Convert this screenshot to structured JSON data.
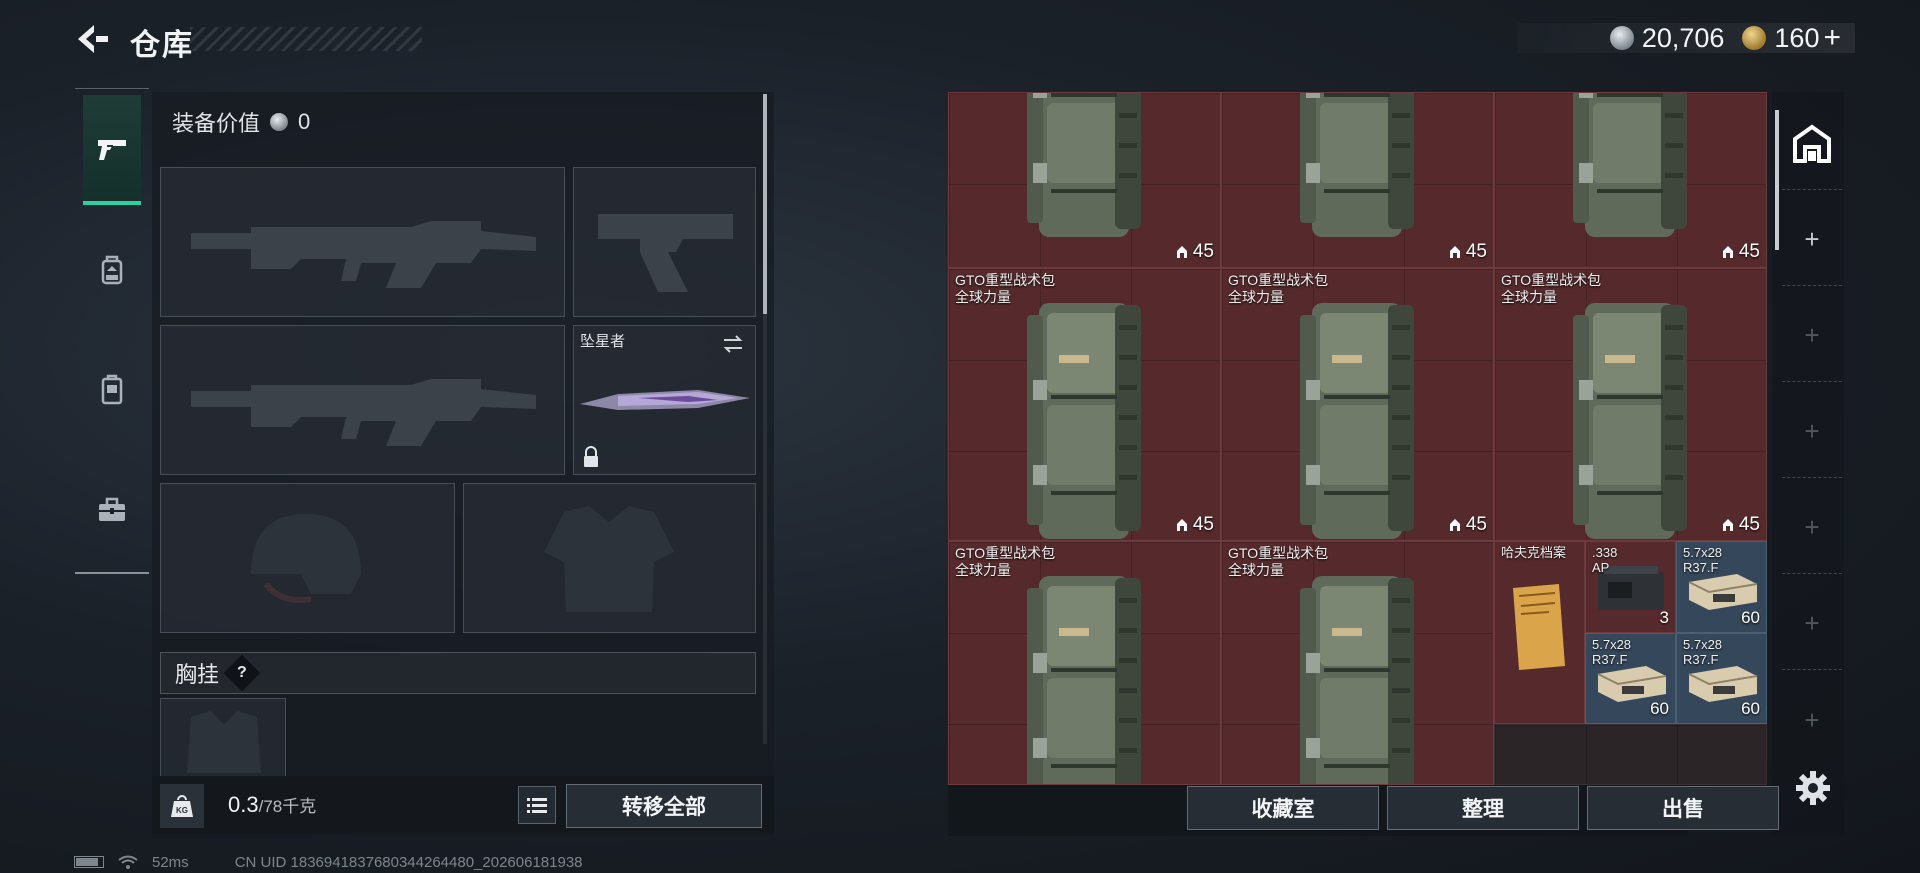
{
  "header": {
    "title": "仓库",
    "currency_silver": "20,706",
    "currency_gold": "160",
    "currency_gold_plus": "+"
  },
  "left_nav": {
    "items": [
      {
        "icon": "pistol-icon",
        "active": true
      },
      {
        "icon": "backpack-icon",
        "active": false
      },
      {
        "icon": "vest-icon",
        "active": false
      },
      {
        "icon": "toolbox-icon",
        "active": false
      }
    ]
  },
  "loadout": {
    "value_label": "装备价值",
    "value": "0",
    "melee_label": "坠星者",
    "chest_rig_label": "胸挂",
    "chest_rig_help": "?",
    "weight_current": "0.3",
    "weight_max": "/78千克",
    "transfer_all": "转移全部"
  },
  "warehouse": {
    "cells": [
      {
        "name": "",
        "sub": "",
        "count": "45"
      },
      {
        "name": "",
        "sub": "",
        "count": "45"
      },
      {
        "name": "",
        "sub": "",
        "count": "45"
      },
      {
        "name": "GTO重型战术包",
        "sub": "全球力量",
        "count": "45"
      },
      {
        "name": "GTO重型战术包",
        "sub": "全球力量",
        "count": "45"
      },
      {
        "name": "GTO重型战术包",
        "sub": "全球力量",
        "count": "45"
      },
      {
        "name": "GTO重型战术包",
        "sub": "全球力量",
        "count": ""
      },
      {
        "name": "GTO重型战术包",
        "sub": "全球力量",
        "count": ""
      }
    ],
    "small_items": [
      {
        "name": "哈夫克档案",
        "sub": "",
        "count": ""
      },
      {
        "name": ".338",
        "sub": "AP",
        "count": "3"
      },
      {
        "name": "5.7x28",
        "sub": "R37.F",
        "count": "60"
      },
      {
        "name": "5.7x28",
        "sub": "R37.F",
        "count": "60"
      },
      {
        "name": "5.7x28",
        "sub": "R37.F",
        "count": "60"
      }
    ],
    "buttons": {
      "collection": "收藏室",
      "organize": "整理",
      "sell": "出售"
    },
    "rail_plus": "+"
  },
  "status": {
    "ping": "52ms",
    "uid": "CN UID 1836941837680344264480_202606181938"
  }
}
